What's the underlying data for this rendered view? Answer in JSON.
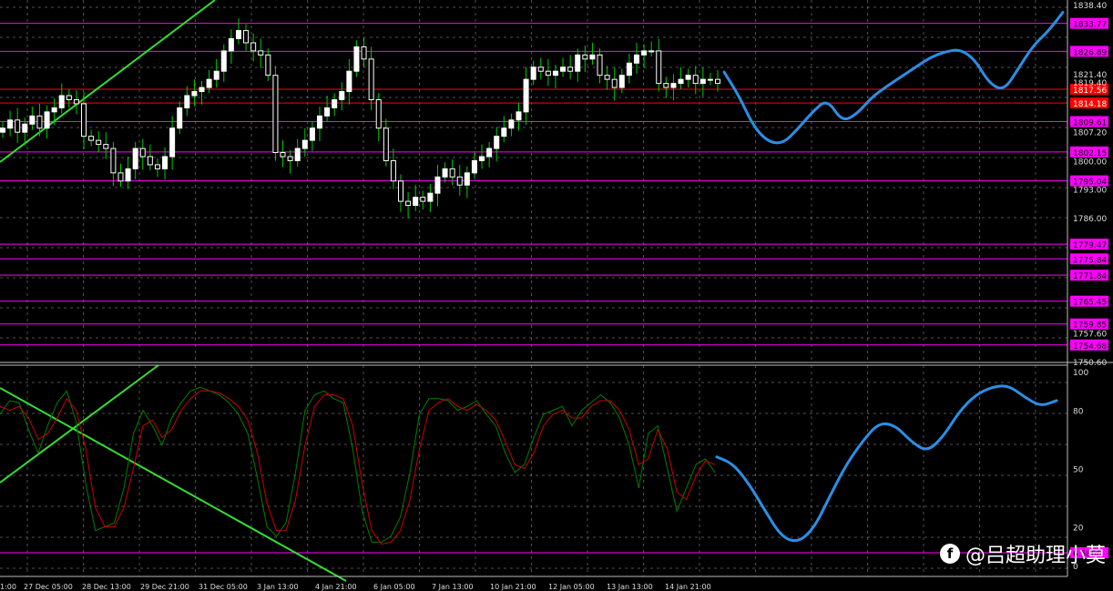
{
  "chart_data": [
    {
      "type": "candlestick",
      "panel": "price",
      "ylim": [
        1750.6,
        1838.4
      ],
      "y_ticks": [
        1838.4,
        1821.4,
        1819.4,
        1807.2,
        1800.0,
        1793.0,
        1786.0,
        1757.6,
        1750.6
      ],
      "level_labels": [
        {
          "value": 1833.77,
          "label": "1833.77",
          "color": "#ff00ff"
        },
        {
          "value": 1826.89,
          "label": "1826.89",
          "color": "#ff00ff"
        },
        {
          "value": 1817.56,
          "label": "1817.56",
          "color": "#ff0000"
        },
        {
          "value": 1814.18,
          "label": "1814.18",
          "color": "#ff0000"
        },
        {
          "value": 1809.61,
          "label": "1809.61",
          "color": "#ff00ff"
        },
        {
          "value": 1802.15,
          "label": "1802.15",
          "color": "#ff00ff"
        },
        {
          "value": 1795.04,
          "label": "1795.04",
          "color": "#ff00ff"
        },
        {
          "value": 1779.47,
          "label": "1779.47",
          "color": "#ff00ff"
        },
        {
          "value": 1775.84,
          "label": "1775.84",
          "color": "#ff00ff"
        },
        {
          "value": 1771.84,
          "label": "1771.84",
          "color": "#ff00ff"
        },
        {
          "value": 1765.45,
          "label": "1765.45",
          "color": "#ff00ff"
        },
        {
          "value": 1759.85,
          "label": "1759.85",
          "color": "#ff00ff"
        },
        {
          "value": 1754.68,
          "label": "1754.68",
          "color": "#ff00ff"
        }
      ],
      "closes": [
        1808,
        1810,
        1807,
        1809,
        1811,
        1808,
        1812,
        1813,
        1816,
        1815,
        1814,
        1806,
        1805,
        1804,
        1803,
        1797,
        1795,
        1798,
        1803,
        1801,
        1799,
        1798,
        1801,
        1808,
        1813,
        1816,
        1817,
        1818,
        1820,
        1822,
        1827,
        1830,
        1832,
        1829,
        1827,
        1826,
        1821,
        1802,
        1801,
        1800,
        1803,
        1805,
        1808,
        1811,
        1813,
        1815,
        1817,
        1822,
        1828,
        1825,
        1815,
        1808,
        1800,
        1795,
        1790,
        1789,
        1791,
        1790,
        1792,
        1796,
        1798,
        1796,
        1794,
        1797,
        1800,
        1801,
        1803,
        1806,
        1808,
        1810,
        1812,
        1820,
        1823,
        1822,
        1821,
        1822,
        1823,
        1822,
        1826,
        1825,
        1826,
        1821,
        1820,
        1818,
        1821,
        1824,
        1826,
        1827,
        1827,
        1819,
        1818,
        1819,
        1820,
        1821,
        1819,
        1820,
        1820,
        1819
      ],
      "bull_color": "#ffffff",
      "bear_color": "#ffffff",
      "wick_color": "#00cc00",
      "forecast_color": "#2a8fe6",
      "forecast_y": [
        1821.8,
        1816.0,
        1808.4,
        1804.6,
        1804.2,
        1807.8,
        1812.0,
        1815.2,
        1809.6,
        1811.4,
        1815.5,
        1818.2,
        1820.6,
        1823.0,
        1825.4,
        1826.8,
        1827.4,
        1825.0,
        1819.0,
        1817.2,
        1822.8,
        1828.4,
        1831.8,
        1836.5
      ]
    },
    {
      "type": "line",
      "panel": "oscillator",
      "ylim": [
        0,
        100
      ],
      "y_ticks": [
        100,
        80,
        50,
        20,
        0
      ],
      "level_labels": [
        {
          "value": 6.5868,
          "label": "6.5868",
          "color": "#ff00ff"
        }
      ],
      "series": [
        {
          "color": "#008000",
          "values": [
            78,
            85,
            84,
            70,
            58,
            72,
            84,
            90,
            74,
            42,
            18,
            20,
            22,
            40,
            68,
            80,
            72,
            62,
            76,
            84,
            90,
            92,
            90,
            88,
            84,
            78,
            68,
            45,
            20,
            15,
            22,
            48,
            80,
            88,
            90,
            86,
            84,
            60,
            28,
            12,
            12,
            15,
            25,
            48,
            78,
            86,
            86,
            85,
            80,
            82,
            85,
            78,
            72,
            58,
            48,
            52,
            66,
            78,
            80,
            82,
            72,
            80,
            84,
            88,
            84,
            76,
            62,
            40,
            68,
            72,
            50,
            28,
            40,
            52,
            55,
            48
          ]
        },
        {
          "color": "#cc0000",
          "values": [
            82,
            80,
            82,
            76,
            65,
            68,
            76,
            86,
            80,
            60,
            30,
            20,
            20,
            30,
            50,
            72,
            75,
            66,
            70,
            80,
            86,
            90,
            90,
            89,
            86,
            82,
            75,
            58,
            32,
            18,
            18,
            34,
            62,
            82,
            88,
            88,
            86,
            72,
            42,
            18,
            11,
            12,
            18,
            34,
            60,
            80,
            84,
            86,
            82,
            80,
            83,
            80,
            75,
            64,
            52,
            50,
            58,
            72,
            78,
            80,
            76,
            76,
            82,
            85,
            85,
            80,
            70,
            52,
            55,
            70,
            60,
            38,
            34,
            46,
            54,
            52
          ]
        }
      ],
      "forecast_color": "#2a8fe6",
      "forecast_y": [
        56.0,
        52.5,
        42.0,
        28.0,
        14.8,
        11.8,
        19.0,
        36.0,
        52.0,
        64.0,
        73.5,
        72.5,
        64.0,
        58.5,
        66.5,
        79.5,
        88.0,
        92.0,
        93.0,
        87.0,
        82.0,
        85.0
      ]
    }
  ],
  "x_axis": {
    "labels": [
      "1:00",
      "27 Dec 05:00",
      "28 Dec 13:00",
      "29 Dec 21:00",
      "31 Dec 05:00",
      "3 Jan 13:00",
      "4 Jan 21:00",
      "6 Jan 05:00",
      "7 Jan 13:00",
      "10 Jan 21:00",
      "12 Jan 05:00",
      "13 Jan 13:00",
      "14 Jan 21:00"
    ]
  },
  "watermark": {
    "icon": "f-logo-icon",
    "text": "@吕超助理小莫"
  }
}
